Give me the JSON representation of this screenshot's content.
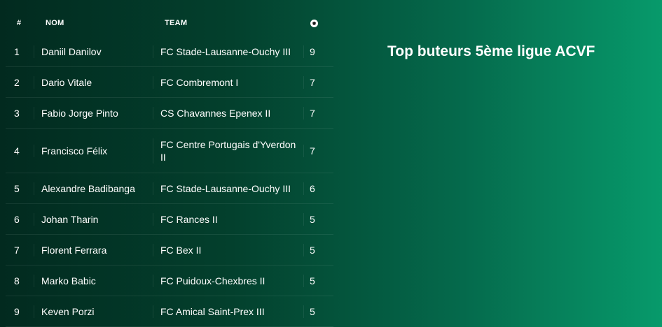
{
  "title": "Top buteurs 5ème ligue ACVF",
  "table": {
    "headers": {
      "rank": "#",
      "name": "NOM",
      "team": "TEAM",
      "goals_icon": "soccer-ball-icon"
    },
    "rows": [
      {
        "rank": "1",
        "name": "Daniil Danilov",
        "team": "FC Stade-Lausanne-Ouchy III",
        "goals": "9"
      },
      {
        "rank": "2",
        "name": "Dario Vitale",
        "team": "FC Combremont I",
        "goals": "7"
      },
      {
        "rank": "3",
        "name": "Fabio Jorge Pinto",
        "team": "CS Chavannes Epenex II",
        "goals": "7"
      },
      {
        "rank": "4",
        "name": "Francisco Félix",
        "team": "FC Centre Portugais d'Yverdon II",
        "goals": "7"
      },
      {
        "rank": "5",
        "name": "Alexandre Badibanga",
        "team": "FC Stade-Lausanne-Ouchy III",
        "goals": "6"
      },
      {
        "rank": "6",
        "name": "Johan Tharin",
        "team": "FC Rances II",
        "goals": "5"
      },
      {
        "rank": "7",
        "name": "Florent Ferrara",
        "team": "FC Bex II",
        "goals": "5"
      },
      {
        "rank": "8",
        "name": "Marko Babic",
        "team": "FC Puidoux-Chexbres II",
        "goals": "5"
      },
      {
        "rank": "9",
        "name": "Keven Porzi",
        "team": "FC Amical Saint-Prex III",
        "goals": "5"
      }
    ]
  },
  "colors": {
    "bg_dark": "#022a1f",
    "bg_light": "#079a6b",
    "text": "#ffffff"
  }
}
